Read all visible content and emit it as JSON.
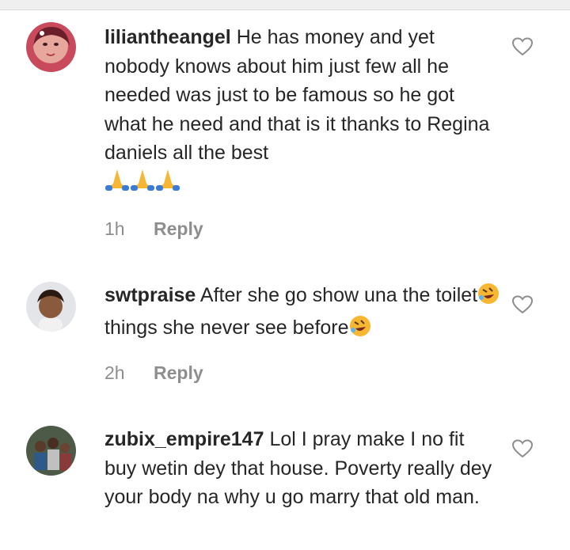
{
  "comments": [
    {
      "username": "liliantheangel",
      "text": "He has money and yet nobody knows about him just few all he needed was just to be famous so he got what he need and that is it thanks to Regina daniels all the best",
      "emoji_icons": [
        "folded-hands-icon",
        "folded-hands-icon",
        "folded-hands-icon"
      ],
      "time": "1h",
      "reply_label": "Reply"
    },
    {
      "username": "swtpraise",
      "text_part1": "After she go show una the toilet",
      "text_part2": " things she never see before",
      "emoji_icons": [
        "rolling-laughing-face-icon",
        "rolling-laughing-face-icon"
      ],
      "time": "2h",
      "reply_label": "Reply"
    },
    {
      "username": "zubix_empire147",
      "text": "Lol I pray make I no fit buy wetin dey that house. Poverty really dey your body na why u go marry that old man."
    }
  ],
  "colors": {
    "text": "#262626",
    "muted": "#8e8e8e",
    "topbar": "#efefef"
  }
}
